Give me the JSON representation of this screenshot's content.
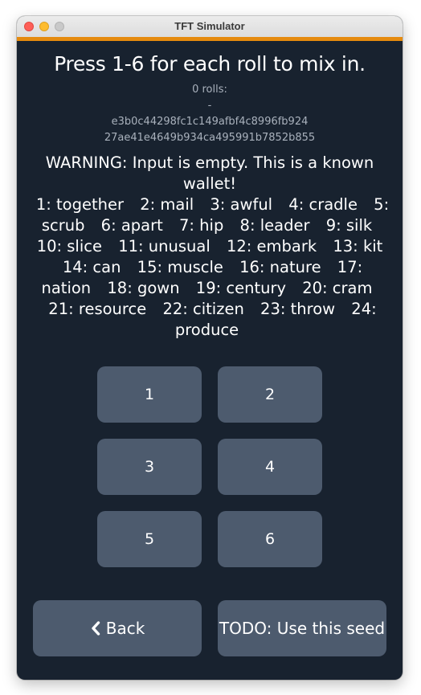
{
  "window": {
    "title": "TFT Simulator"
  },
  "heading": "Press 1-6 for each roll to mix in.",
  "rolls_count": "0 rolls:",
  "rolls_value": "-",
  "hash_line_1": "e3b0c44298fc1c149afbf4c8996fb924",
  "hash_line_2": "27ae41e4649b934ca495991b7852b855",
  "warning": "WARNING: Input is empty. This is a known wallet!",
  "words": [
    "1: together",
    "2: mail",
    "3: awful",
    "4: cradle",
    "5: scrub",
    "6: apart",
    "7: hip",
    "8: leader",
    "9: silk",
    "10: slice",
    "11: unusual",
    "12: embark",
    "13: kit",
    "14: can",
    "15: muscle",
    "16: nature",
    "17: nation",
    "18: gown",
    "19: century",
    "20: cram",
    "21: resource",
    "22: citizen",
    "23: throw",
    "24: produce"
  ],
  "keypad": [
    "1",
    "2",
    "3",
    "4",
    "5",
    "6"
  ],
  "buttons": {
    "back_label": "Back",
    "use_seed_label": "TODO: Use this seed"
  },
  "icons": {
    "back": "chevron-left-icon"
  },
  "colors": {
    "background": "#18222f",
    "button": "#4d5b6e",
    "accent": "#e58a0e",
    "muted_text": "#a9b1bc"
  }
}
